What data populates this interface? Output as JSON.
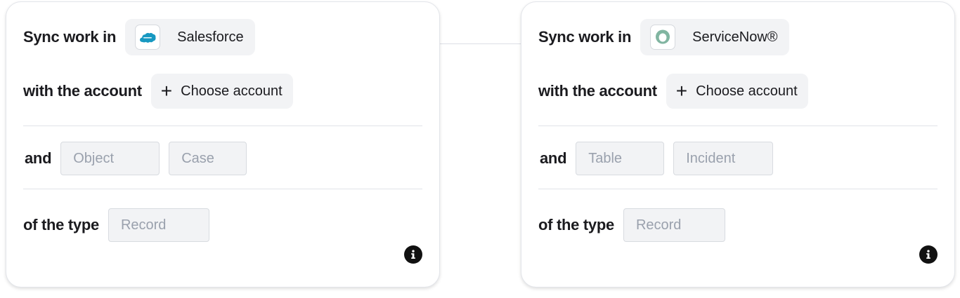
{
  "labels": {
    "sync_work_in": "Sync work in",
    "with_the_account": "with the account",
    "and": "and",
    "of_the_type": "of the type"
  },
  "left": {
    "app_name": "Salesforce",
    "app_icon": "salesforce-icon",
    "choose_account": "Choose account",
    "field_1_placeholder": "Object",
    "field_2_placeholder": "Case",
    "type_placeholder": "Record"
  },
  "right": {
    "app_name": "ServiceNow®",
    "app_icon": "servicenow-icon",
    "choose_account": "Choose account",
    "field_1_placeholder": "Table",
    "field_2_placeholder": "Incident",
    "type_placeholder": "Record"
  },
  "icons": {
    "plus": "+",
    "info": "info-icon"
  },
  "colors": {
    "salesforce_blue": "#1798c1",
    "servicenow_green": "#81b5a1",
    "chip_bg": "#f2f3f5",
    "placeholder_text": "#9aa1ad"
  }
}
